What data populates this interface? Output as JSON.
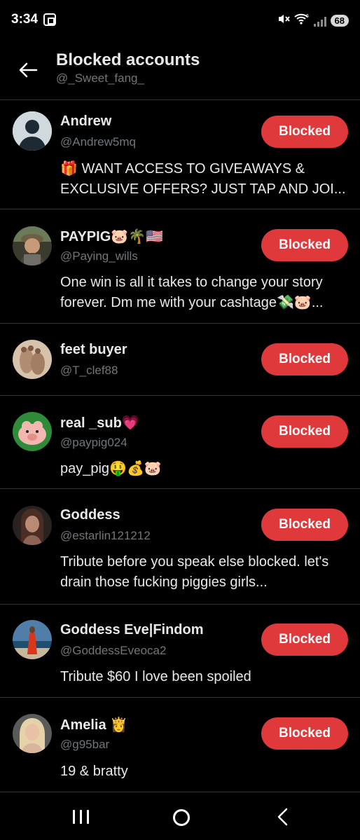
{
  "status": {
    "time": "3:34",
    "battery": "68",
    "wifi_badge": "6"
  },
  "header": {
    "title": "Blocked accounts",
    "subtitle": "@_Sweet_fang_"
  },
  "accounts": [
    {
      "name": "Andrew",
      "handle": "@Andrew5mq",
      "bio": "🎁 WANT ACCESS TO GIVEAWAYS & EXCLUSIVE OFFERS? JUST TAP AND JOI...",
      "button": "Blocked",
      "avatar": "default-avatar-icon"
    },
    {
      "name": "PAYPIG🐷🌴🇺🇸",
      "handle": "@Paying_wills",
      "bio": "One win is all it takes to change your story forever. Dm me with your cashtage💸🐷...",
      "button": "Blocked",
      "avatar": "photo-man-cap"
    },
    {
      "name": "feet buyer",
      "handle": "@T_clef88",
      "bio": "",
      "button": "Blocked",
      "avatar": "photo-feet"
    },
    {
      "name": "real _sub💗",
      "handle": "@paypig024",
      "bio": "pay_pig🤑💰🐷",
      "button": "Blocked",
      "avatar": "pig-cartoon"
    },
    {
      "name": "Goddess",
      "handle": "@estarlin121212",
      "bio": "Tribute before you speak else blocked. let's drain those fucking piggies girls...",
      "button": "Blocked",
      "avatar": "photo-woman-dark"
    },
    {
      "name": "Goddess Eve|Findom",
      "handle": "@GoddessEveoca2",
      "bio": "Tribute $60 I love been spoiled",
      "button": "Blocked",
      "avatar": "photo-woman-beach"
    },
    {
      "name": "Amelia 👸",
      "handle": "@g95bar",
      "bio": "19 & bratty",
      "button": "Blocked",
      "avatar": "photo-woman-blonde"
    }
  ],
  "colors": {
    "background": "#000000",
    "button": "#e0393b",
    "secondary_text": "#71767b",
    "divider": "#2f3336"
  }
}
